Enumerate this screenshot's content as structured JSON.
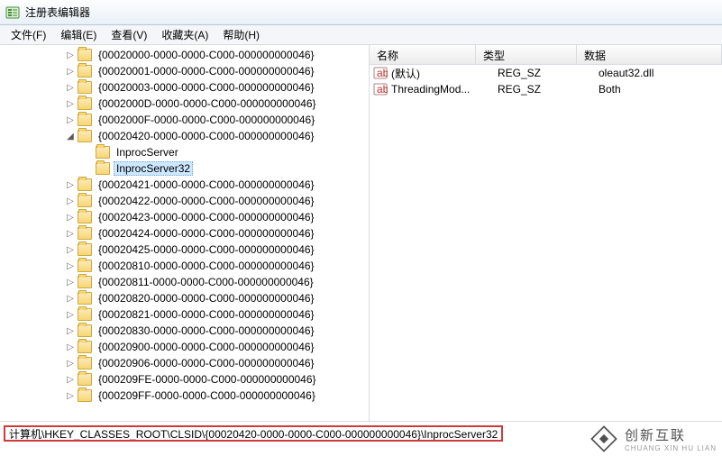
{
  "window": {
    "title": "注册表编辑器"
  },
  "menu": {
    "file": "文件(F)",
    "edit": "编辑(E)",
    "view": "查看(V)",
    "favorites": "收藏夹(A)",
    "help": "帮助(H)"
  },
  "tree": {
    "base_indent": 72,
    "items": [
      {
        "indent": 0,
        "expand": "closed",
        "label": "{00020000-0000-0000-C000-000000000046}"
      },
      {
        "indent": 0,
        "expand": "closed",
        "label": "{00020001-0000-0000-C000-000000000046}"
      },
      {
        "indent": 0,
        "expand": "closed",
        "label": "{00020003-0000-0000-C000-000000000046}"
      },
      {
        "indent": 0,
        "expand": "closed",
        "label": "{0002000D-0000-0000-C000-000000000046}"
      },
      {
        "indent": 0,
        "expand": "closed",
        "label": "{0002000F-0000-0000-C000-000000000046}"
      },
      {
        "indent": 0,
        "expand": "open",
        "label": "{00020420-0000-0000-C000-000000000046}"
      },
      {
        "indent": 1,
        "expand": "none",
        "label": "InprocServer"
      },
      {
        "indent": 1,
        "expand": "none",
        "label": "InprocServer32",
        "selected": true
      },
      {
        "indent": 0,
        "expand": "closed",
        "label": "{00020421-0000-0000-C000-000000000046}"
      },
      {
        "indent": 0,
        "expand": "closed",
        "label": "{00020422-0000-0000-C000-000000000046}"
      },
      {
        "indent": 0,
        "expand": "closed",
        "label": "{00020423-0000-0000-C000-000000000046}"
      },
      {
        "indent": 0,
        "expand": "closed",
        "label": "{00020424-0000-0000-C000-000000000046}"
      },
      {
        "indent": 0,
        "expand": "closed",
        "label": "{00020425-0000-0000-C000-000000000046}"
      },
      {
        "indent": 0,
        "expand": "closed",
        "label": "{00020810-0000-0000-C000-000000000046}"
      },
      {
        "indent": 0,
        "expand": "closed",
        "label": "{00020811-0000-0000-C000-000000000046}"
      },
      {
        "indent": 0,
        "expand": "closed",
        "label": "{00020820-0000-0000-C000-000000000046}"
      },
      {
        "indent": 0,
        "expand": "closed",
        "label": "{00020821-0000-0000-C000-000000000046}"
      },
      {
        "indent": 0,
        "expand": "closed",
        "label": "{00020830-0000-0000-C000-000000000046}"
      },
      {
        "indent": 0,
        "expand": "closed",
        "label": "{00020900-0000-0000-C000-000000000046}"
      },
      {
        "indent": 0,
        "expand": "closed",
        "label": "{00020906-0000-0000-C000-000000000046}"
      },
      {
        "indent": 0,
        "expand": "closed",
        "label": "{000209FE-0000-0000-C000-000000000046}"
      },
      {
        "indent": 0,
        "expand": "closed",
        "label": "{000209FF-0000-0000-C000-000000000046}"
      }
    ]
  },
  "columns": {
    "name": "名称",
    "type": "类型",
    "data": "数据"
  },
  "values": [
    {
      "name": "(默认)",
      "type": "REG_SZ",
      "data": "oleaut32.dll"
    },
    {
      "name": "ThreadingMod...",
      "type": "REG_SZ",
      "data": "Both"
    }
  ],
  "status": {
    "path": "计算机\\HKEY_CLASSES_ROOT\\CLSID\\{00020420-0000-0000-C000-000000000046}\\InprocServer32"
  },
  "watermark": {
    "zh": "创新互联",
    "pinyin": "CHUANG XIN HU LIAN"
  }
}
